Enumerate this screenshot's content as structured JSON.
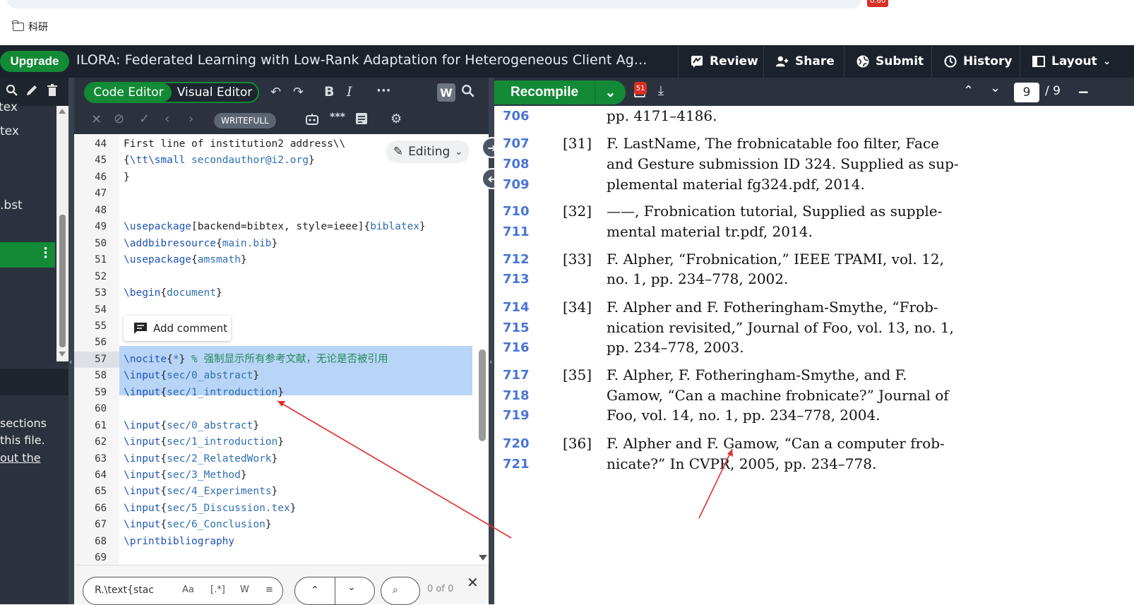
{
  "browser": {
    "bookmark": "科研",
    "badge": "0.60"
  },
  "topbar": {
    "upgrade": "Upgrade",
    "title": "ILORA: Federated Learning with Low-Rank Adaptation for Heterogeneous Client Ag...",
    "review": "Review",
    "share": "Share",
    "submit": "Submit",
    "history": "History",
    "layout": "Layout"
  },
  "filetree": {
    "items": [
      "tex",
      "tex",
      ".bst"
    ],
    "outline_text": [
      "sections",
      "this file.",
      "out the"
    ]
  },
  "editor": {
    "mode_code": "Code Editor",
    "mode_visual": "Visual Editor",
    "writefull": "WRITEFULL",
    "editing": "Editing",
    "add_comment": "Add comment",
    "lines": [
      {
        "n": "44",
        "t": "First line of institution2 address\\\\"
      },
      {
        "n": "45",
        "t": "{\\tt\\small secondauthor@i2.org}"
      },
      {
        "n": "46",
        "t": "}"
      },
      {
        "n": "47",
        "t": ""
      },
      {
        "n": "48",
        "t": ""
      },
      {
        "n": "49",
        "t": "\\usepackage[backend=bibtex, style=ieee]{biblatex}"
      },
      {
        "n": "50",
        "t": "\\addbibresource{main.bib}"
      },
      {
        "n": "51",
        "t": "\\usepackage{amsmath}"
      },
      {
        "n": "52",
        "t": ""
      },
      {
        "n": "53",
        "t": "\\begin{document}"
      },
      {
        "n": "54",
        "t": ""
      },
      {
        "n": "55",
        "t": ""
      },
      {
        "n": "56",
        "t": ""
      },
      {
        "n": "57",
        "t": "\\nocite{*} % 强制显示所有参考文献，无论是否被引用"
      },
      {
        "n": "58",
        "t": "\\input{sec/0_abstract}"
      },
      {
        "n": "59",
        "t": "\\input{sec/1_introduction}"
      },
      {
        "n": "60",
        "t": ""
      },
      {
        "n": "61",
        "t": "\\input{sec/0_abstract}"
      },
      {
        "n": "62",
        "t": "\\input{sec/1_introduction}"
      },
      {
        "n": "63",
        "t": "\\input{sec/2_RelatedWork}"
      },
      {
        "n": "64",
        "t": "\\input{sec/3_Method}"
      },
      {
        "n": "65",
        "t": "\\input{sec/4_Experiments}"
      },
      {
        "n": "66",
        "t": "\\input{sec/5_Discussion.tex}"
      },
      {
        "n": "67",
        "t": "\\input{sec/6_Conclusion}"
      },
      {
        "n": "68",
        "t": "\\printbibliography"
      },
      {
        "n": "69",
        "t": ""
      }
    ],
    "search_value": "R.\\text{stac",
    "search_count": "0 of 0"
  },
  "pdf": {
    "recompile": "Recompile",
    "error_count": "51",
    "page_current": "9",
    "page_total": "/ 9",
    "lines": [
      {
        "ln": "706",
        "num": "",
        "text": "pp. 4171–4186."
      },
      {
        "ln": "707",
        "num": "[31]",
        "text": "F. LastName, The frobnicatable foo filter, Face"
      },
      {
        "ln": "708",
        "num": "",
        "text": "and Gesture submission ID 324. Supplied as sup-"
      },
      {
        "ln": "709",
        "num": "",
        "text": "plemental material fg324.pdf, 2014."
      },
      {
        "ln": "710",
        "num": "[32]",
        "text": "——, Frobnication tutorial, Supplied as supple-"
      },
      {
        "ln": "711",
        "num": "",
        "text": "mental material tr.pdf, 2014."
      },
      {
        "ln": "712",
        "num": "[33]",
        "text": "F. Alpher, “Frobnication,” IEEE TPAMI, vol. 12,"
      },
      {
        "ln": "713",
        "num": "",
        "text": "no. 1, pp. 234–778, 2002."
      },
      {
        "ln": "714",
        "num": "[34]",
        "text": "F. Alpher and F. Fotheringham-Smythe, “Frob-"
      },
      {
        "ln": "715",
        "num": "",
        "text": "nication revisited,” Journal of Foo, vol. 13, no. 1,"
      },
      {
        "ln": "716",
        "num": "",
        "text": "pp. 234–778, 2003."
      },
      {
        "ln": "717",
        "num": "[35]",
        "text": "F. Alpher, F. Fotheringham-Smythe, and F."
      },
      {
        "ln": "718",
        "num": "",
        "text": "Gamow, “Can a machine frobnicate?” Journal of"
      },
      {
        "ln": "719",
        "num": "",
        "text": "Foo, vol. 14, no. 1, pp. 234–778, 2004."
      },
      {
        "ln": "720",
        "num": "[36]",
        "text": "F. Alpher and F. Gamow, “Can a computer frob-"
      },
      {
        "ln": "721",
        "num": "",
        "text": "nicate?” In CVPR, 2005, pp. 234–778."
      }
    ]
  },
  "colors": {
    "brand_green": "#138a36",
    "toolbar_dark": "#2b323d",
    "annotation_red": "#e03030",
    "pdf_linenum_blue": "#4a74d6"
  }
}
